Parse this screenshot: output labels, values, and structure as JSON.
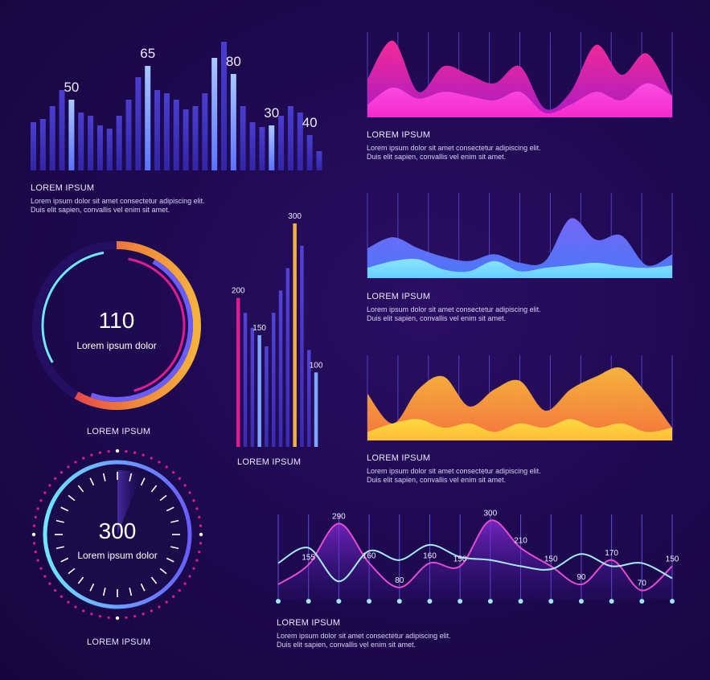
{
  "colors": {
    "background": "#1f0a52",
    "bar_dark": "#3d33b8",
    "bar_light": "#7ea6ff",
    "magenta": "#e01a8f",
    "gold": "#f4b13d",
    "blue": "#6f6fff",
    "cyan": "#6fe6ff"
  },
  "chart_data": [
    {
      "id": "top-left-bars",
      "type": "bar",
      "title": "LOREM IPSUM",
      "description": [
        "Lorem  ipsum  dolor  sit  amet consectetur adipiscing elit.",
        "Duis elit sapien, convallis vel enim sit amet."
      ],
      "values": [
        30,
        32,
        40,
        50,
        44,
        36,
        34,
        28,
        26,
        34,
        44,
        58,
        65,
        50,
        48,
        44,
        38,
        40,
        48,
        70,
        80,
        60,
        40,
        30,
        27,
        28,
        34,
        40,
        36,
        22,
        12
      ],
      "highlighted": [
        4,
        12,
        19,
        21,
        25
      ],
      "annotations": [
        {
          "index": 4,
          "label": "50"
        },
        {
          "index": 12,
          "label": "65"
        },
        {
          "index": 21,
          "label": "80"
        },
        {
          "index": 25,
          "label": "30"
        },
        {
          "index": 29,
          "label": "40"
        }
      ],
      "ylim": [
        0,
        85
      ]
    },
    {
      "id": "middle-bars",
      "type": "bar",
      "title": "LOREM IPSUM",
      "values": [
        200,
        180,
        160,
        150,
        135,
        180,
        210,
        240,
        300,
        270,
        130,
        100
      ],
      "colors_by_index": {
        "0": "#e01a8f",
        "3": "#7ea6ff",
        "8": "#f4b13d",
        "11": "#7ea6ff"
      },
      "annotations": [
        {
          "index": 0,
          "label": "200"
        },
        {
          "index": 3,
          "label": "150"
        },
        {
          "index": 8,
          "label": "300"
        },
        {
          "index": 11,
          "label": "100"
        }
      ],
      "ylim": [
        0,
        300
      ]
    },
    {
      "id": "area-magenta",
      "type": "area",
      "title": "LOREM IPSUM",
      "description": [
        "Lorem  ipsum  dolor  sit  amet consectetur adipiscing elit.",
        "Duis elit sapien, convallis vel enim sit amet."
      ],
      "series": [
        {
          "values": [
            45,
            90,
            30,
            60,
            50,
            40,
            60,
            10,
            30,
            85,
            50,
            75,
            25
          ],
          "color": "#e01a8f"
        },
        {
          "values": [
            15,
            35,
            22,
            30,
            25,
            20,
            30,
            5,
            15,
            30,
            20,
            40,
            25
          ],
          "color": "#ff3bf0"
        }
      ],
      "ylim": [
        0,
        100
      ]
    },
    {
      "id": "area-blue",
      "type": "area",
      "title": "LOREM IPSUM",
      "description": [
        "Lorem  ipsum  dolor  sit  amet consectetur adipiscing elit.",
        "Duis elit sapien, convallis vel enim sit amet."
      ],
      "series": [
        {
          "values": [
            35,
            48,
            35,
            25,
            20,
            28,
            18,
            20,
            70,
            45,
            50,
            15,
            28
          ],
          "color": "#6f6fff"
        },
        {
          "values": [
            12,
            20,
            22,
            10,
            8,
            20,
            8,
            12,
            15,
            18,
            14,
            12,
            15
          ],
          "color": "#6fe6ff"
        }
      ],
      "ylim": [
        0,
        100
      ]
    },
    {
      "id": "area-gold",
      "type": "area",
      "title": "LOREM IPSUM",
      "description": [
        "Lorem  ipsum  dolor  sit  amet consectetur adipiscing elit.",
        "Duis elit sapien, convallis vel enim sit amet."
      ],
      "series": [
        {
          "values": [
            55,
            20,
            60,
            75,
            40,
            60,
            70,
            35,
            60,
            75,
            85,
            55,
            15
          ],
          "color": "#f5a23a"
        },
        {
          "values": [
            10,
            20,
            25,
            15,
            20,
            10,
            20,
            15,
            25,
            15,
            20,
            10,
            15
          ],
          "color": "#ffd23d"
        }
      ],
      "ylim": [
        0,
        100
      ]
    },
    {
      "id": "bottom-lines",
      "type": "line",
      "title": "LOREM IPSUM",
      "description": [
        "Lorem  ipsum  dolor  sit  amet consectetur adipiscing elit.",
        "Duis elit sapien, convallis vel enim sit amet."
      ],
      "series": [
        {
          "color": "#e64bd0",
          "values": [
            90,
            155,
            290,
            160,
            80,
            160,
            150,
            300,
            210,
            150,
            90,
            170,
            70,
            150
          ]
        },
        {
          "color": "#a7e9ff",
          "values": [
            160,
            210,
            100,
            200,
            170,
            220,
            180,
            170,
            150,
            140,
            190,
            150,
            160,
            110
          ]
        }
      ],
      "labels": [
        {
          "index": 1,
          "label": "155"
        },
        {
          "index": 2,
          "label": "290"
        },
        {
          "index": 3,
          "label": "160"
        },
        {
          "index": 4,
          "label": "80"
        },
        {
          "index": 5,
          "label": "160"
        },
        {
          "index": 6,
          "label": "150"
        },
        {
          "index": 7,
          "label": "300"
        },
        {
          "index": 8,
          "label": "210"
        },
        {
          "index": 9,
          "label": "150"
        },
        {
          "index": 10,
          "label": "90"
        },
        {
          "index": 11,
          "label": "170"
        },
        {
          "index": 12,
          "label": "70"
        },
        {
          "index": 13,
          "label": "150"
        }
      ],
      "ylim": [
        40,
        320
      ]
    }
  ],
  "gauges": [
    {
      "id": "ring-gauge",
      "value": "110",
      "caption": "Lorem ipsum dolor",
      "title": "LOREM IPSUM"
    },
    {
      "id": "dial-gauge",
      "value": "300",
      "caption": "Lorem ipsum dolor",
      "title": "LOREM IPSUM"
    }
  ]
}
